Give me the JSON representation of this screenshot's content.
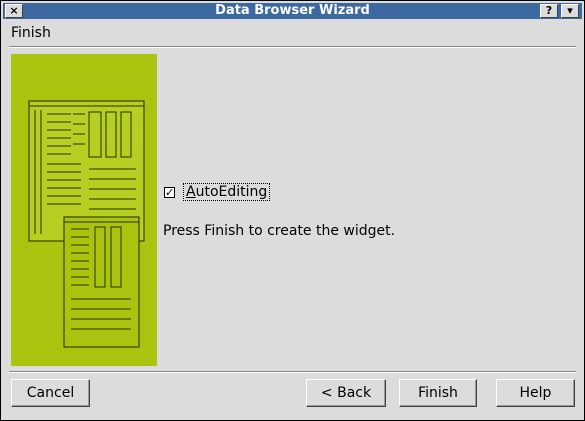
{
  "window": {
    "title": "Data Browser Wizard",
    "close_glyph": "×",
    "help_glyph": "?",
    "menu_glyph": "▾"
  },
  "page": {
    "heading": "Finish"
  },
  "options": {
    "autoediting": {
      "label_first": "A",
      "label_rest": "utoEditing",
      "checked": true,
      "check_glyph": "✓"
    }
  },
  "message": "Press Finish to create the widget.",
  "buttons": {
    "cancel": "Cancel",
    "back": "< Back",
    "finish": "Finish",
    "help": "Help"
  },
  "colors": {
    "title_bar": "#3c6aa0",
    "illustration_bg": "#a9c30f",
    "window_bg": "#dcdcdc"
  },
  "icons": {
    "illustration": "spreadsheet-forms-illustration"
  }
}
